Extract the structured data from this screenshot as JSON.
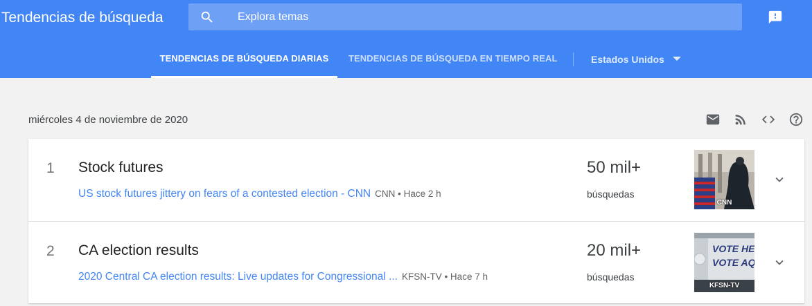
{
  "header": {
    "app_title": "Tendencias de búsqueda",
    "search_placeholder": "Explora temas",
    "search_icon": "search-icon",
    "feedback_icon": "feedback-icon",
    "color": "#4285f4"
  },
  "tabs": [
    {
      "label": "TENDENCIAS DE BÚSQUEDA DIARIAS",
      "active": true
    },
    {
      "label": "TENDENCIAS DE BÚSQUEDA EN TIEMPO REAL",
      "active": false
    }
  ],
  "region": {
    "selected": "Estados Unidos"
  },
  "date": "miércoles 4 de noviembre de 2020",
  "toolbar_icons": [
    "email-icon",
    "rss-icon",
    "embed-code-icon",
    "help-icon"
  ],
  "trends": [
    {
      "rank": "1",
      "topic": "Stock futures",
      "article_title": "US stock futures jittery on fears of a contested election - CNN",
      "article_meta": "CNN • Hace 2 h",
      "count": "50 mil+",
      "count_label": "búsquedas",
      "image_source": "CNN"
    },
    {
      "rank": "2",
      "topic": "CA election results",
      "article_title": "2020 Central CA election results: Live updates for Congressional ...",
      "article_meta": "KFSN-TV • Hace 7 h",
      "count": "20 mil+",
      "count_label": "búsquedas",
      "image_source": "KFSN-TV",
      "image_text": [
        "VOTE HE",
        "VOTE AQ"
      ]
    }
  ]
}
